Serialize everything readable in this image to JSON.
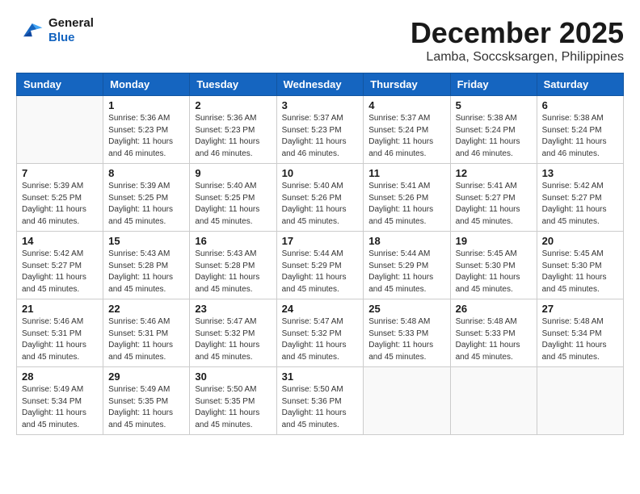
{
  "header": {
    "logo_line1": "General",
    "logo_line2": "Blue",
    "month": "December 2025",
    "location": "Lamba, Soccsksargen, Philippines"
  },
  "weekdays": [
    "Sunday",
    "Monday",
    "Tuesday",
    "Wednesday",
    "Thursday",
    "Friday",
    "Saturday"
  ],
  "weeks": [
    [
      {
        "day": "",
        "sunrise": "",
        "sunset": "",
        "daylight": ""
      },
      {
        "day": "1",
        "sunrise": "Sunrise: 5:36 AM",
        "sunset": "Sunset: 5:23 PM",
        "daylight": "Daylight: 11 hours and 46 minutes."
      },
      {
        "day": "2",
        "sunrise": "Sunrise: 5:36 AM",
        "sunset": "Sunset: 5:23 PM",
        "daylight": "Daylight: 11 hours and 46 minutes."
      },
      {
        "day": "3",
        "sunrise": "Sunrise: 5:37 AM",
        "sunset": "Sunset: 5:23 PM",
        "daylight": "Daylight: 11 hours and 46 minutes."
      },
      {
        "day": "4",
        "sunrise": "Sunrise: 5:37 AM",
        "sunset": "Sunset: 5:24 PM",
        "daylight": "Daylight: 11 hours and 46 minutes."
      },
      {
        "day": "5",
        "sunrise": "Sunrise: 5:38 AM",
        "sunset": "Sunset: 5:24 PM",
        "daylight": "Daylight: 11 hours and 46 minutes."
      },
      {
        "day": "6",
        "sunrise": "Sunrise: 5:38 AM",
        "sunset": "Sunset: 5:24 PM",
        "daylight": "Daylight: 11 hours and 46 minutes."
      }
    ],
    [
      {
        "day": "7",
        "sunrise": "Sunrise: 5:39 AM",
        "sunset": "Sunset: 5:25 PM",
        "daylight": "Daylight: 11 hours and 46 minutes."
      },
      {
        "day": "8",
        "sunrise": "Sunrise: 5:39 AM",
        "sunset": "Sunset: 5:25 PM",
        "daylight": "Daylight: 11 hours and 45 minutes."
      },
      {
        "day": "9",
        "sunrise": "Sunrise: 5:40 AM",
        "sunset": "Sunset: 5:25 PM",
        "daylight": "Daylight: 11 hours and 45 minutes."
      },
      {
        "day": "10",
        "sunrise": "Sunrise: 5:40 AM",
        "sunset": "Sunset: 5:26 PM",
        "daylight": "Daylight: 11 hours and 45 minutes."
      },
      {
        "day": "11",
        "sunrise": "Sunrise: 5:41 AM",
        "sunset": "Sunset: 5:26 PM",
        "daylight": "Daylight: 11 hours and 45 minutes."
      },
      {
        "day": "12",
        "sunrise": "Sunrise: 5:41 AM",
        "sunset": "Sunset: 5:27 PM",
        "daylight": "Daylight: 11 hours and 45 minutes."
      },
      {
        "day": "13",
        "sunrise": "Sunrise: 5:42 AM",
        "sunset": "Sunset: 5:27 PM",
        "daylight": "Daylight: 11 hours and 45 minutes."
      }
    ],
    [
      {
        "day": "14",
        "sunrise": "Sunrise: 5:42 AM",
        "sunset": "Sunset: 5:27 PM",
        "daylight": "Daylight: 11 hours and 45 minutes."
      },
      {
        "day": "15",
        "sunrise": "Sunrise: 5:43 AM",
        "sunset": "Sunset: 5:28 PM",
        "daylight": "Daylight: 11 hours and 45 minutes."
      },
      {
        "day": "16",
        "sunrise": "Sunrise: 5:43 AM",
        "sunset": "Sunset: 5:28 PM",
        "daylight": "Daylight: 11 hours and 45 minutes."
      },
      {
        "day": "17",
        "sunrise": "Sunrise: 5:44 AM",
        "sunset": "Sunset: 5:29 PM",
        "daylight": "Daylight: 11 hours and 45 minutes."
      },
      {
        "day": "18",
        "sunrise": "Sunrise: 5:44 AM",
        "sunset": "Sunset: 5:29 PM",
        "daylight": "Daylight: 11 hours and 45 minutes."
      },
      {
        "day": "19",
        "sunrise": "Sunrise: 5:45 AM",
        "sunset": "Sunset: 5:30 PM",
        "daylight": "Daylight: 11 hours and 45 minutes."
      },
      {
        "day": "20",
        "sunrise": "Sunrise: 5:45 AM",
        "sunset": "Sunset: 5:30 PM",
        "daylight": "Daylight: 11 hours and 45 minutes."
      }
    ],
    [
      {
        "day": "21",
        "sunrise": "Sunrise: 5:46 AM",
        "sunset": "Sunset: 5:31 PM",
        "daylight": "Daylight: 11 hours and 45 minutes."
      },
      {
        "day": "22",
        "sunrise": "Sunrise: 5:46 AM",
        "sunset": "Sunset: 5:31 PM",
        "daylight": "Daylight: 11 hours and 45 minutes."
      },
      {
        "day": "23",
        "sunrise": "Sunrise: 5:47 AM",
        "sunset": "Sunset: 5:32 PM",
        "daylight": "Daylight: 11 hours and 45 minutes."
      },
      {
        "day": "24",
        "sunrise": "Sunrise: 5:47 AM",
        "sunset": "Sunset: 5:32 PM",
        "daylight": "Daylight: 11 hours and 45 minutes."
      },
      {
        "day": "25",
        "sunrise": "Sunrise: 5:48 AM",
        "sunset": "Sunset: 5:33 PM",
        "daylight": "Daylight: 11 hours and 45 minutes."
      },
      {
        "day": "26",
        "sunrise": "Sunrise: 5:48 AM",
        "sunset": "Sunset: 5:33 PM",
        "daylight": "Daylight: 11 hours and 45 minutes."
      },
      {
        "day": "27",
        "sunrise": "Sunrise: 5:48 AM",
        "sunset": "Sunset: 5:34 PM",
        "daylight": "Daylight: 11 hours and 45 minutes."
      }
    ],
    [
      {
        "day": "28",
        "sunrise": "Sunrise: 5:49 AM",
        "sunset": "Sunset: 5:34 PM",
        "daylight": "Daylight: 11 hours and 45 minutes."
      },
      {
        "day": "29",
        "sunrise": "Sunrise: 5:49 AM",
        "sunset": "Sunset: 5:35 PM",
        "daylight": "Daylight: 11 hours and 45 minutes."
      },
      {
        "day": "30",
        "sunrise": "Sunrise: 5:50 AM",
        "sunset": "Sunset: 5:35 PM",
        "daylight": "Daylight: 11 hours and 45 minutes."
      },
      {
        "day": "31",
        "sunrise": "Sunrise: 5:50 AM",
        "sunset": "Sunset: 5:36 PM",
        "daylight": "Daylight: 11 hours and 45 minutes."
      },
      {
        "day": "",
        "sunrise": "",
        "sunset": "",
        "daylight": ""
      },
      {
        "day": "",
        "sunrise": "",
        "sunset": "",
        "daylight": ""
      },
      {
        "day": "",
        "sunrise": "",
        "sunset": "",
        "daylight": ""
      }
    ]
  ]
}
